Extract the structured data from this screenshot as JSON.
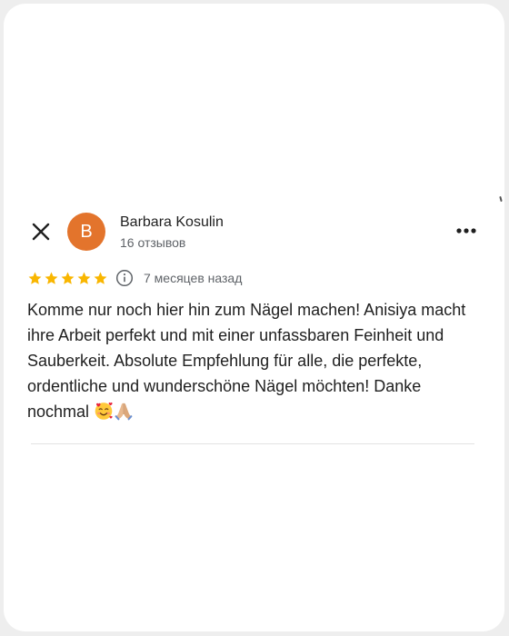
{
  "review": {
    "author": {
      "initial": "B",
      "name": "Barbara Kosulin",
      "reviews_count": "16 отзывов",
      "avatar_color": "#e3742c"
    },
    "rating": 5,
    "date": "7 месяцев назад",
    "text": "Komme nur noch hier hin zum Nägel machen! Anisiya macht ihre Arbeit perfekt und mit einer unfassbaren Feinheit und Sauberkeit. Absolute Empfehlung für alle, die perfekte, ordentliche und wunderschöne Nägel möchten! Danke nochmal",
    "emojis": [
      "smiling-face-with-hearts",
      "folded-hands"
    ]
  },
  "icons": {
    "close": "close-icon",
    "more": "more-horiz-icon",
    "info": "info-icon",
    "star": "star-icon"
  },
  "colors": {
    "star": "#f9b600",
    "avatar": "#e3742c",
    "text_primary": "#1f1f1f",
    "text_secondary": "#5f6368"
  }
}
